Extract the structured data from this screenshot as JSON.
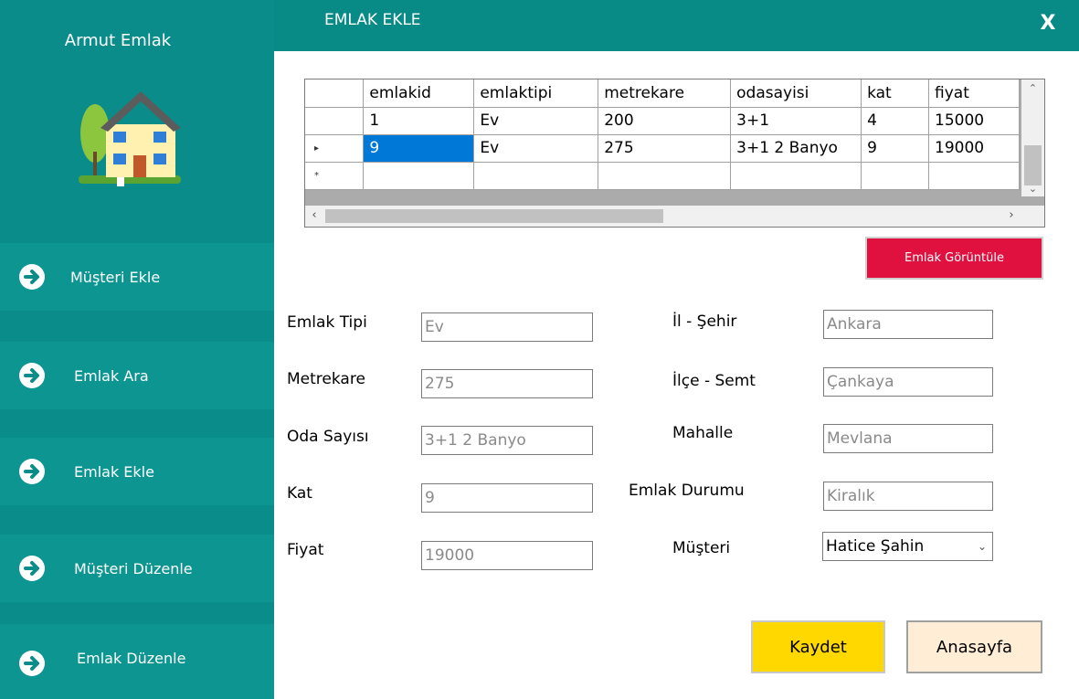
{
  "sidebar": {
    "app_title": "Armut Emlak",
    "items": [
      {
        "label": "Müşteri Ekle"
      },
      {
        "label": "Emlak Ara"
      },
      {
        "label": "Emlak Ekle"
      },
      {
        "label": "Müşteri Düzenle"
      },
      {
        "label": "Emlak Düzenle"
      }
    ]
  },
  "header": {
    "title": "EMLAK EKLE",
    "close_label": "X"
  },
  "grid": {
    "columns": [
      "emlakid",
      "emlaktipi",
      "metrekare",
      "odasayisi",
      "kat",
      "fiyat"
    ],
    "rows": [
      {
        "marker": "",
        "cells": [
          "1",
          "Ev",
          "200",
          "3+1",
          "4",
          "15000"
        ]
      },
      {
        "marker": "▸",
        "cells": [
          "9",
          "Ev",
          "275",
          "3+1 2 Banyo",
          "9",
          "19000"
        ]
      },
      {
        "marker": "*",
        "cells": [
          "",
          "",
          "",
          "",
          "",
          ""
        ]
      }
    ]
  },
  "buttons": {
    "view": "Emlak Görüntüle",
    "save": "Kaydet",
    "home": "Anasayfa"
  },
  "form": {
    "left": [
      {
        "label": "Emlak Tipi",
        "value": "Ev"
      },
      {
        "label": "Metrekare",
        "value": "275"
      },
      {
        "label": "Oda Sayısı",
        "value": "3+1 2 Banyo"
      },
      {
        "label": "Kat",
        "value": "9"
      },
      {
        "label": "Fiyat",
        "value": "19000"
      }
    ],
    "right": [
      {
        "label": "İl - Şehir",
        "value": "Ankara"
      },
      {
        "label": "İlçe - Semt",
        "value": "Çankaya"
      },
      {
        "label": "Mahalle",
        "value": "Mevlana"
      },
      {
        "label": "Emlak Durumu",
        "value": "Kiralık"
      },
      {
        "label": "Müşteri",
        "value": "Hatice Şahin"
      }
    ]
  },
  "colors": {
    "sidebar": "#0a8d8a",
    "accent_red": "#e0103f",
    "save_yellow": "#ffd800",
    "selection": "#0078d7"
  }
}
